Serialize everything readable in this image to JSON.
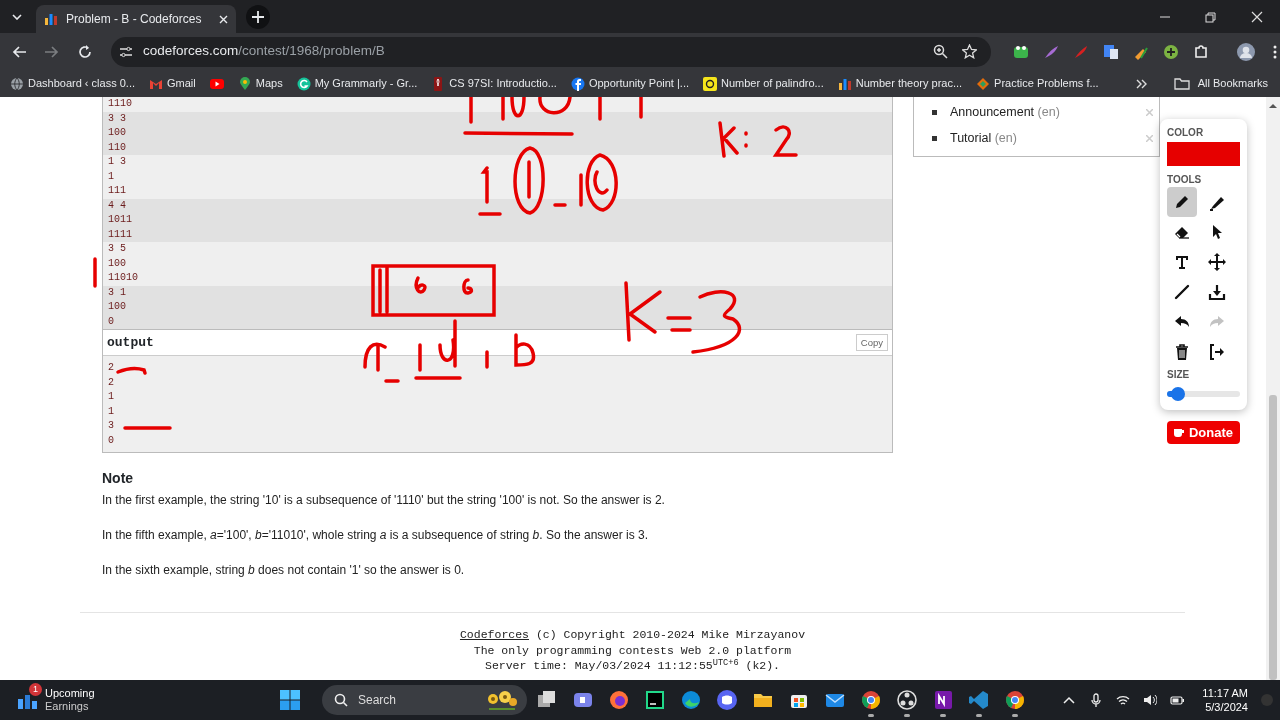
{
  "browser": {
    "tab": {
      "title": "Problem - B - Codeforces"
    },
    "url": {
      "host": "codeforces.com",
      "path": "/contest/1968/problem/B"
    },
    "bookmarks": [
      {
        "kind": "globe",
        "label": "Dashboard ‹ class 0..."
      },
      {
        "kind": "mail",
        "label": "Gmail"
      },
      {
        "kind": "video"
      },
      {
        "kind": "pin",
        "label": "Maps"
      },
      {
        "kind": "circle",
        "label": "My Grammarly - Gr..."
      },
      {
        "kind": "flame",
        "label": "CS 97SI: Introductio..."
      },
      {
        "kind": "facebook",
        "label": "Opportunity Point |..."
      },
      {
        "kind": "badge",
        "label": "Number of palindro..."
      },
      {
        "kind": "bars",
        "label": "Number theory prac..."
      },
      {
        "kind": "diamond",
        "label": "Practice Problems f..."
      }
    ],
    "all_bookmarks": "All Bookmarks"
  },
  "sidebar_links": [
    {
      "label": "Announcement",
      "lang": "(en)"
    },
    {
      "label": "Tutorial",
      "lang": "(en)"
    }
  ],
  "input_groups": [
    {
      "lines": [
        "1110"
      ]
    },
    {
      "lines": [
        "3 3",
        "100",
        "110"
      ]
    },
    {
      "lines": [
        "1 3",
        "1",
        "111"
      ]
    },
    {
      "lines": [
        "4 4",
        "1011",
        "1111"
      ]
    },
    {
      "lines": [
        "3 5",
        "100",
        "11010"
      ]
    },
    {
      "lines": [
        "3 1",
        "100",
        "0"
      ]
    }
  ],
  "output": {
    "title": "output",
    "copy": "Copy",
    "lines": [
      "2",
      "2",
      "1",
      "1",
      "3",
      "0"
    ]
  },
  "note": {
    "title": "Note",
    "paragraphs": [
      "In the first example, the string '10' is a subsequence of '1110' but the string '100' is not. So the answer is 2.",
      "In the fifth example, *a*='100', *b*='11010', whole string *a* is a subsequence of string *b*. So the answer is 3.",
      "In the sixth example, string *b* does not contain '1' so the answer is 0."
    ]
  },
  "footer": {
    "link": "Codeforces",
    "copyright": "(c) Copyright 2010-2024 Mike Mirzayanov",
    "tagline": "The only programming contests Web 2.0 platform",
    "server_time": "Server time: May/03/2024 11:12:55$^{UTC+6}$ (k2)."
  },
  "drawing_tool": {
    "color_label": "COLOR",
    "color": "#e60000",
    "tools_label": "TOOLS",
    "tools": [
      {
        "kind": "pencil",
        "selected": true,
        "disabled": false
      },
      {
        "kind": "highlighter",
        "selected": false,
        "disabled": false
      },
      {
        "kind": "eraser",
        "selected": false,
        "disabled": false
      },
      {
        "kind": "pointer",
        "selected": false,
        "disabled": false
      },
      {
        "kind": "text",
        "selected": false,
        "disabled": false
      },
      {
        "kind": "move",
        "selected": false,
        "disabled": false
      },
      {
        "kind": "line",
        "selected": false,
        "disabled": false
      },
      {
        "kind": "download",
        "selected": false,
        "disabled": false
      },
      {
        "kind": "undo",
        "selected": false,
        "disabled": false
      },
      {
        "kind": "redo",
        "selected": false,
        "disabled": true
      },
      {
        "kind": "trash",
        "selected": false,
        "disabled": false
      },
      {
        "kind": "exit",
        "selected": false,
        "disabled": false
      }
    ],
    "size_label": "SIZE",
    "size": {
      "level": 0.15
    }
  },
  "donate": "Donate",
  "taskbar": {
    "widget": {
      "badge": "1",
      "title": "Upcoming",
      "subtitle": "Earnings"
    },
    "search": {
      "placeholder": "Search"
    },
    "apps": [
      {
        "kind": "taskview",
        "running": false
      },
      {
        "kind": "chat",
        "running": false
      },
      {
        "kind": "firefox",
        "running": false
      },
      {
        "kind": "pycharm",
        "running": false
      },
      {
        "kind": "edge",
        "running": false
      },
      {
        "kind": "discord",
        "running": false
      },
      {
        "kind": "folder",
        "running": false
      },
      {
        "kind": "store",
        "running": false
      },
      {
        "kind": "mail",
        "running": false
      },
      {
        "kind": "chrome",
        "running": true
      },
      {
        "kind": "obs",
        "running": true
      },
      {
        "kind": "onenote",
        "running": true
      },
      {
        "kind": "vscode",
        "running": true
      },
      {
        "kind": "chrome",
        "running": true
      }
    ],
    "time": "11:17 AM",
    "date": "5/3/2024"
  }
}
